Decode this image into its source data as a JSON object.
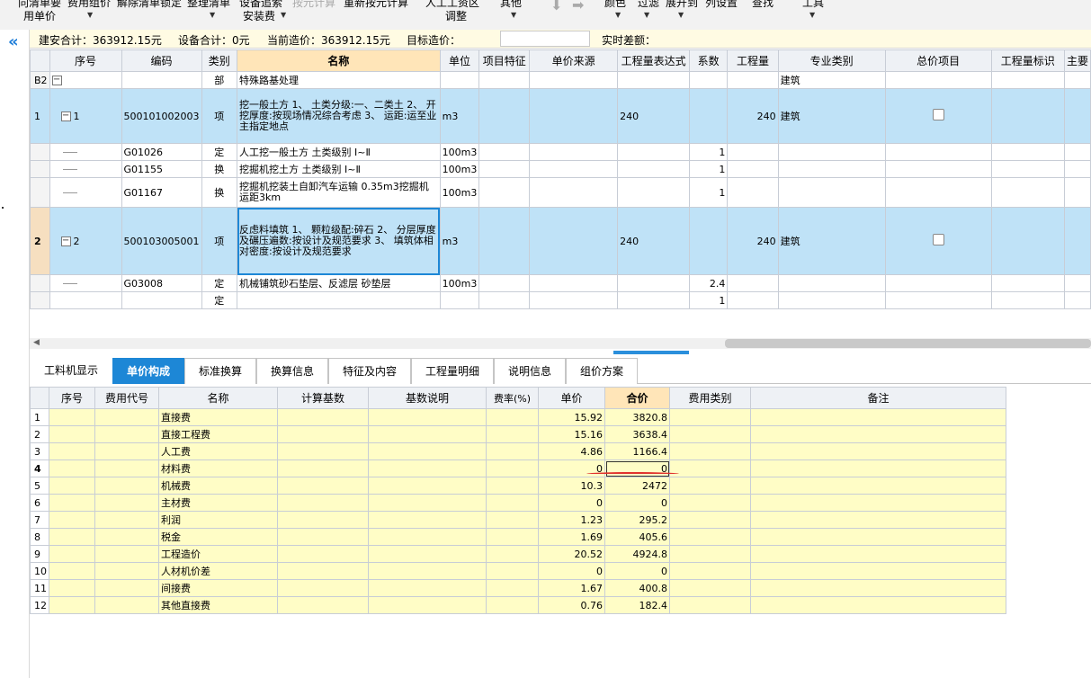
{
  "toolbar": {
    "items": [
      "向清单要",
      "费用组价",
      "解除清单锁定",
      "整理清单",
      "设备追索",
      "按元计算",
      "重新按元计算",
      "人工工资区",
      "其他",
      "颜色",
      "过滤",
      "展开到",
      "列设置",
      "查找",
      "工具"
    ],
    "sub": [
      "用单价",
      "安装费",
      "调整"
    ]
  },
  "summary": {
    "construct": "建安合计：363912.15元",
    "equipment": "设备合计：0元",
    "current": "当前造价：363912.15元",
    "target_label": "目标造价：",
    "target_value": "",
    "diff": "实时差额："
  },
  "upper": {
    "headers": [
      "序号",
      "编码",
      "类别",
      "名称",
      "单位",
      "项目特征",
      "单价来源",
      "工程量表达式",
      "系数",
      "工程量",
      "专业类别",
      "总价项目",
      "工程量标识",
      "主要"
    ],
    "rows": [
      {
        "idx": "B2",
        "seq": "",
        "code": "",
        "type": "部",
        "name": "特殊路基处理",
        "unit": "",
        "expr": "",
        "coef": "",
        "qty": "",
        "prof": "建筑"
      },
      {
        "idx": "1",
        "seq": "1",
        "code": "500101002003",
        "type": "项",
        "name": "挖一般土方\n1、 土类分级:一、二类土\n2、 开挖厚度:按现场情况综合考虑\n3、 运距:运至业主指定地点",
        "unit": "m3",
        "expr": "240",
        "coef": "",
        "qty": "240",
        "prof": "建筑"
      },
      {
        "idx": "",
        "seq": "",
        "code": "G01026",
        "type": "定",
        "name": "人工挖一般土方 土类级别 Ⅰ~Ⅱ",
        "unit": "100m3",
        "expr": "",
        "coef": "1",
        "qty": "",
        "prof": ""
      },
      {
        "idx": "",
        "seq": "",
        "code": "G01155",
        "type": "换",
        "name": "挖掘机挖土方 土类级别 Ⅰ~Ⅱ",
        "unit": "100m3",
        "expr": "",
        "coef": "1",
        "qty": "",
        "prof": ""
      },
      {
        "idx": "",
        "seq": "",
        "code": "G01167",
        "type": "换",
        "name": "挖掘机挖装土自卸汽车运输 0.35m3挖掘机运距3km",
        "unit": "100m3",
        "expr": "",
        "coef": "1",
        "qty": "",
        "prof": ""
      },
      {
        "idx": "2",
        "seq": "2",
        "code": "500103005001",
        "type": "项",
        "name": "反虑料填筑\n1、 颗粒级配:碎石\n2、 分层厚度及碾压遍数:按设计及规范要求\n3、 填筑体相对密度:按设计及规范要求",
        "unit": "m3",
        "expr": "240",
        "coef": "",
        "qty": "240",
        "prof": "建筑"
      },
      {
        "idx": "",
        "seq": "",
        "code": "G03008",
        "type": "定",
        "name": "机械铺筑砂石垫层、反滤层 砂垫层",
        "unit": "100m3",
        "expr": "",
        "coef": "2.4",
        "qty": "",
        "prof": ""
      },
      {
        "idx": "",
        "seq": "",
        "code": "",
        "type": "定",
        "name": "",
        "unit": "",
        "expr": "",
        "coef": "1",
        "qty": "",
        "prof": ""
      }
    ]
  },
  "tabs": [
    "工料机显示",
    "单价构成",
    "标准换算",
    "换算信息",
    "特征及内容",
    "工程量明细",
    "说明信息",
    "组价方案"
  ],
  "lower": {
    "headers": [
      "序号",
      "费用代号",
      "名称",
      "计算基数",
      "基数说明",
      "费率(%)",
      "单价",
      "合价",
      "费用类别",
      "备注"
    ],
    "rows": [
      {
        "idx": "1",
        "name": "直接费",
        "price": "15.92",
        "total": "3820.8"
      },
      {
        "idx": "2",
        "name": "直接工程费",
        "price": "15.16",
        "total": "3638.4"
      },
      {
        "idx": "3",
        "name": "人工费",
        "price": "4.86",
        "total": "1166.4"
      },
      {
        "idx": "4",
        "name": "材料费",
        "price": "0",
        "total": "0"
      },
      {
        "idx": "5",
        "name": "机械费",
        "price": "10.3",
        "total": "2472"
      },
      {
        "idx": "6",
        "name": "主材费",
        "price": "0",
        "total": "0"
      },
      {
        "idx": "7",
        "name": "利润",
        "price": "1.23",
        "total": "295.2"
      },
      {
        "idx": "8",
        "name": "税金",
        "price": "1.69",
        "total": "405.6"
      },
      {
        "idx": "9",
        "name": "工程造价",
        "price": "20.52",
        "total": "4924.8"
      },
      {
        "idx": "10",
        "name": "人材机价差",
        "price": "0",
        "total": "0"
      },
      {
        "idx": "11",
        "name": "间接费",
        "price": "1.67",
        "total": "400.8"
      },
      {
        "idx": "12",
        "name": "其他直接费",
        "price": "0.76",
        "total": "182.4"
      }
    ]
  },
  "colors": {
    "accent": "#1d87d6",
    "selected_row": "#bfe2f7",
    "cell_yellow": "#fffdc6",
    "summary_bg": "#fffbe3",
    "annotation": "#e0322d"
  }
}
